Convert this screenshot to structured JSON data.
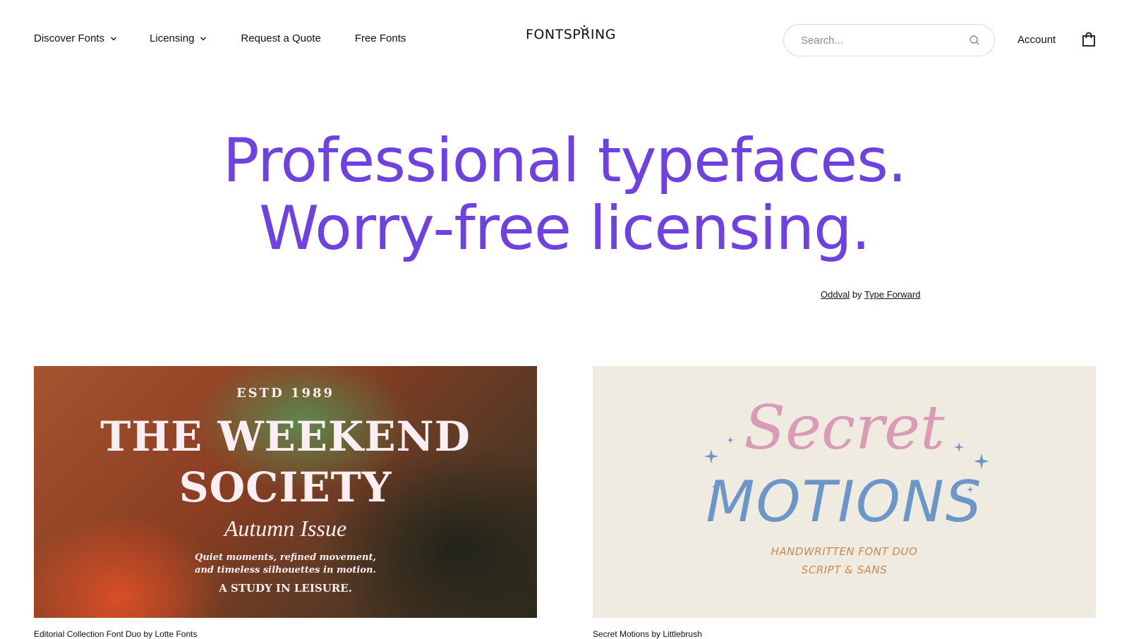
{
  "nav": {
    "discover_label": "Discover Fonts",
    "licensing_label": "Licensing",
    "quote_label": "Request a Quote",
    "free_label": "Free Fonts"
  },
  "logo": {
    "text": "FONTSPRING"
  },
  "search": {
    "placeholder": "Search..."
  },
  "account": {
    "label": "Account"
  },
  "hero": {
    "line1": "Professional typefaces.",
    "line2": "Worry-free licensing.",
    "credit_font": "Oddval",
    "credit_by": "by",
    "credit_foundry": "Type Forward"
  },
  "cards": {
    "left": {
      "estd": "ESTD 1989",
      "title1": "THE WEEKEND",
      "title2": "SOCIETY",
      "issue": "Autumn Issue",
      "tagline1": "Quiet moments, refined movement,",
      "tagline2": "and timeless silhouettes in motion.",
      "study": "A STUDY IN LEISURE.",
      "caption": "Editorial Collection Font Duo by Lotte Fonts"
    },
    "right": {
      "script": "Secret",
      "motions": "MOTIONS",
      "sub1": "HANDWRITTEN FONT DUO",
      "sub2": "SCRIPT & SANS",
      "caption": "Secret Motions by Littlebrush"
    }
  },
  "colors": {
    "accent": "#6f42e0",
    "text": "#111111",
    "search_border": "#dcdcdc",
    "secret_pink": "#d99bb5",
    "secret_blue": "#6c95c8",
    "secret_orange": "#c88a4e"
  },
  "icons": {
    "chevron": "chevron-down-icon",
    "search": "search-icon",
    "cart": "shopping-bag-icon",
    "logo_mark": "sprout-icon"
  }
}
